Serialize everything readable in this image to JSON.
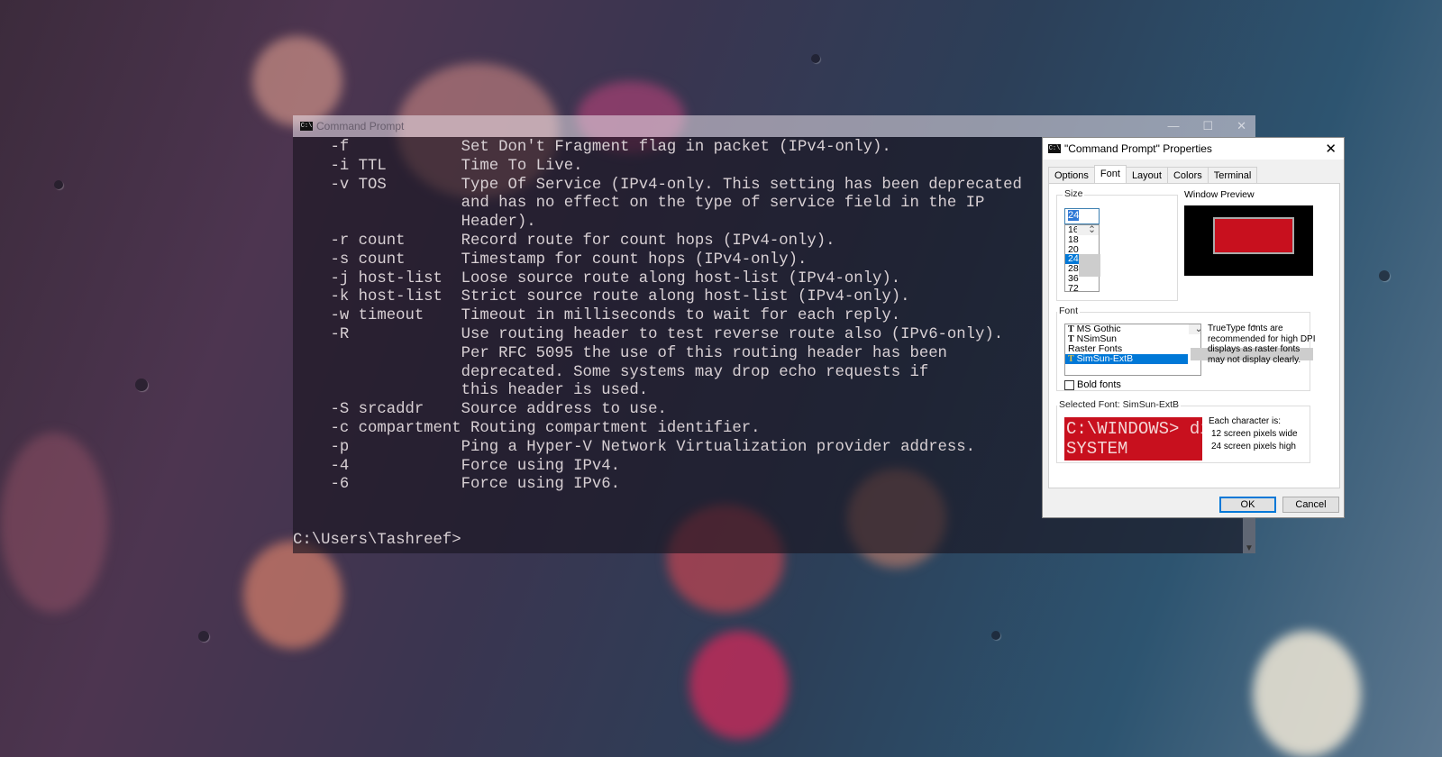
{
  "cmd_window": {
    "title": "Command Prompt",
    "icon": "cmd-icon",
    "lines": [
      "    -f            Set Don't Fragment flag in packet (IPv4-only).",
      "    -i TTL        Time To Live.",
      "    -v TOS        Type Of Service (IPv4-only. This setting has been deprecated",
      "                  and has no effect on the type of service field in the IP",
      "                  Header).",
      "    -r count      Record route for count hops (IPv4-only).",
      "    -s count      Timestamp for count hops (IPv4-only).",
      "    -j host-list  Loose source route along host-list (IPv4-only).",
      "    -k host-list  Strict source route along host-list (IPv4-only).",
      "    -w timeout    Timeout in milliseconds to wait for each reply.",
      "    -R            Use routing header to test reverse route also (IPv6-only).",
      "                  Per RFC 5095 the use of this routing header has been",
      "                  deprecated. Some systems may drop echo requests if",
      "                  this header is used.",
      "    -S srcaddr    Source address to use.",
      "    -c compartment Routing compartment identifier.",
      "    -p            Ping a Hyper-V Network Virtualization provider address.",
      "    -4            Force using IPv4.",
      "    -6            Force using IPv6."
    ],
    "prompt": "C:\\Users\\Tashreef>"
  },
  "dialog": {
    "title": "\"Command Prompt\" Properties",
    "tabs": [
      "Options",
      "Font",
      "Layout",
      "Colors",
      "Terminal"
    ],
    "active_tab": "Font",
    "size": {
      "label": "Size",
      "value": "24",
      "options": [
        "16",
        "18",
        "20",
        "24",
        "28",
        "36",
        "72"
      ],
      "selected": "24"
    },
    "window_preview_label": "Window Preview",
    "font": {
      "label": "Font",
      "items": [
        "MS Gothic",
        "NSimSun",
        "Raster Fonts",
        "SimSun-ExtB"
      ],
      "selected": "SimSun-ExtB",
      "note": "TrueType fonts are recommended for high DPI displays as raster fonts may not display clearly.",
      "bold_label": "Bold fonts",
      "bold_checked": false
    },
    "selected_font": {
      "label": "Selected Font: SimSun-ExtB",
      "sample_line1": "C:\\WINDOWS> dir",
      "sample_line2": "SYSTEM          <DIR>",
      "char_info_title": "Each character is:",
      "char_width": "12 screen pixels wide",
      "char_height": "24 screen pixels high"
    },
    "ok_label": "OK",
    "cancel_label": "Cancel"
  },
  "colors": {
    "sample_bg": "#c8101e",
    "selection": "#0078d7"
  }
}
